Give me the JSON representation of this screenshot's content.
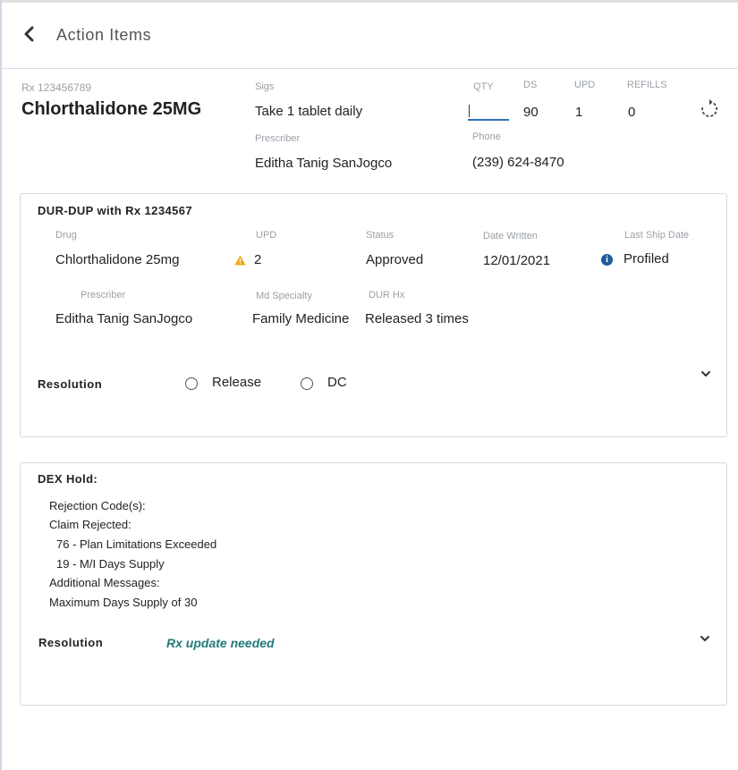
{
  "header": {
    "title": "Action Items"
  },
  "rx": {
    "number": "Rx 123456789",
    "drug": "Chlorthalidone 25MG",
    "sigs_label": "Sigs",
    "sigs": "Take 1 tablet daily",
    "prescriber_label": "Prescriber",
    "prescriber": "Editha Tanig SanJogco",
    "qty_label": "QTY",
    "qty_value": "",
    "ds_label": "DS",
    "ds": "90",
    "upd_label": "UPD",
    "upd": "1",
    "refills_label": "REFILLS",
    "refills": "0",
    "phone_label": "Phone",
    "phone": "(239) 624-8470"
  },
  "dur": {
    "title": "DUR-DUP with Rx 1234567",
    "drug_label": "Drug",
    "drug": "Chlorthalidone 25mg",
    "upd_label": "UPD",
    "upd": "2",
    "status_label": "Status",
    "status": "Approved",
    "date_written_label": "Date Written",
    "date_written": "12/01/2021",
    "last_ship_label": "Last Ship Date",
    "last_ship": "Profiled",
    "prescriber_label": "Prescriber",
    "prescriber": "Editha Tanig SanJogco",
    "specialty_label": "Md Specialty",
    "specialty": "Family Medicine",
    "hx_label": "DUR Hx",
    "hx": "Released 3 times",
    "resolution_label": "Resolution",
    "options": [
      "Release",
      "DC"
    ]
  },
  "dex": {
    "title": "DEX Hold:",
    "rejection_codes": "Rejection Code(s):",
    "claim_rejected": "Claim Rejected:",
    "codes": [
      "76 - Plan Limitations Exceeded",
      "19 - M/I Days Supply"
    ],
    "additional_messages": "Additional Messages:",
    "message": "Maximum Days Supply of 30",
    "resolution_label": "Resolution",
    "resolution_value": "Rx update needed"
  },
  "colors": {
    "accent_blue": "#2f6fb5",
    "warning": "#f2a81d",
    "info": "#1f5d99",
    "teal": "#237b7b"
  }
}
